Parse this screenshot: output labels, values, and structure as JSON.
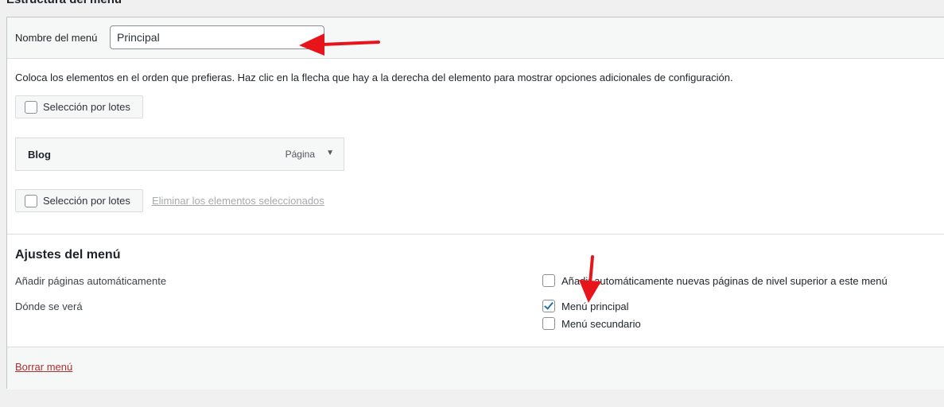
{
  "page": {
    "title_cut": "Estructura del menú"
  },
  "menu_header": {
    "name_label": "Nombre del menú",
    "name_value": "Principal"
  },
  "structure": {
    "instructions": "Coloca los elementos en el orden que prefieras. Haz clic en la flecha que hay a la derecha del elemento para mostrar opciones adicionales de configuración.",
    "bulk_select_label": "Selección por lotes",
    "items": [
      {
        "title": "Blog",
        "type": "Página"
      }
    ],
    "delete_selected_label": "Eliminar los elementos seleccionados"
  },
  "settings": {
    "title": "Ajustes del menú",
    "auto_add_label": "Añadir páginas automáticamente",
    "auto_add_option": "Añadir automáticamente nuevas páginas de nivel superior a este menú",
    "auto_add_checked": false,
    "locations_label": "Dónde se verá",
    "locations": [
      {
        "label": "Menú principal",
        "checked": true
      },
      {
        "label": "Menú secundario",
        "checked": false
      }
    ]
  },
  "footer": {
    "delete_menu_label": "Borrar menú"
  },
  "colors": {
    "annotation_arrow": "#e8141c",
    "delete_link": "#b32d2e",
    "checkbox_check": "#2271b1"
  },
  "icons": {
    "item_toggle": "triangle-down-icon",
    "annotation": "red-arrow-icon"
  }
}
